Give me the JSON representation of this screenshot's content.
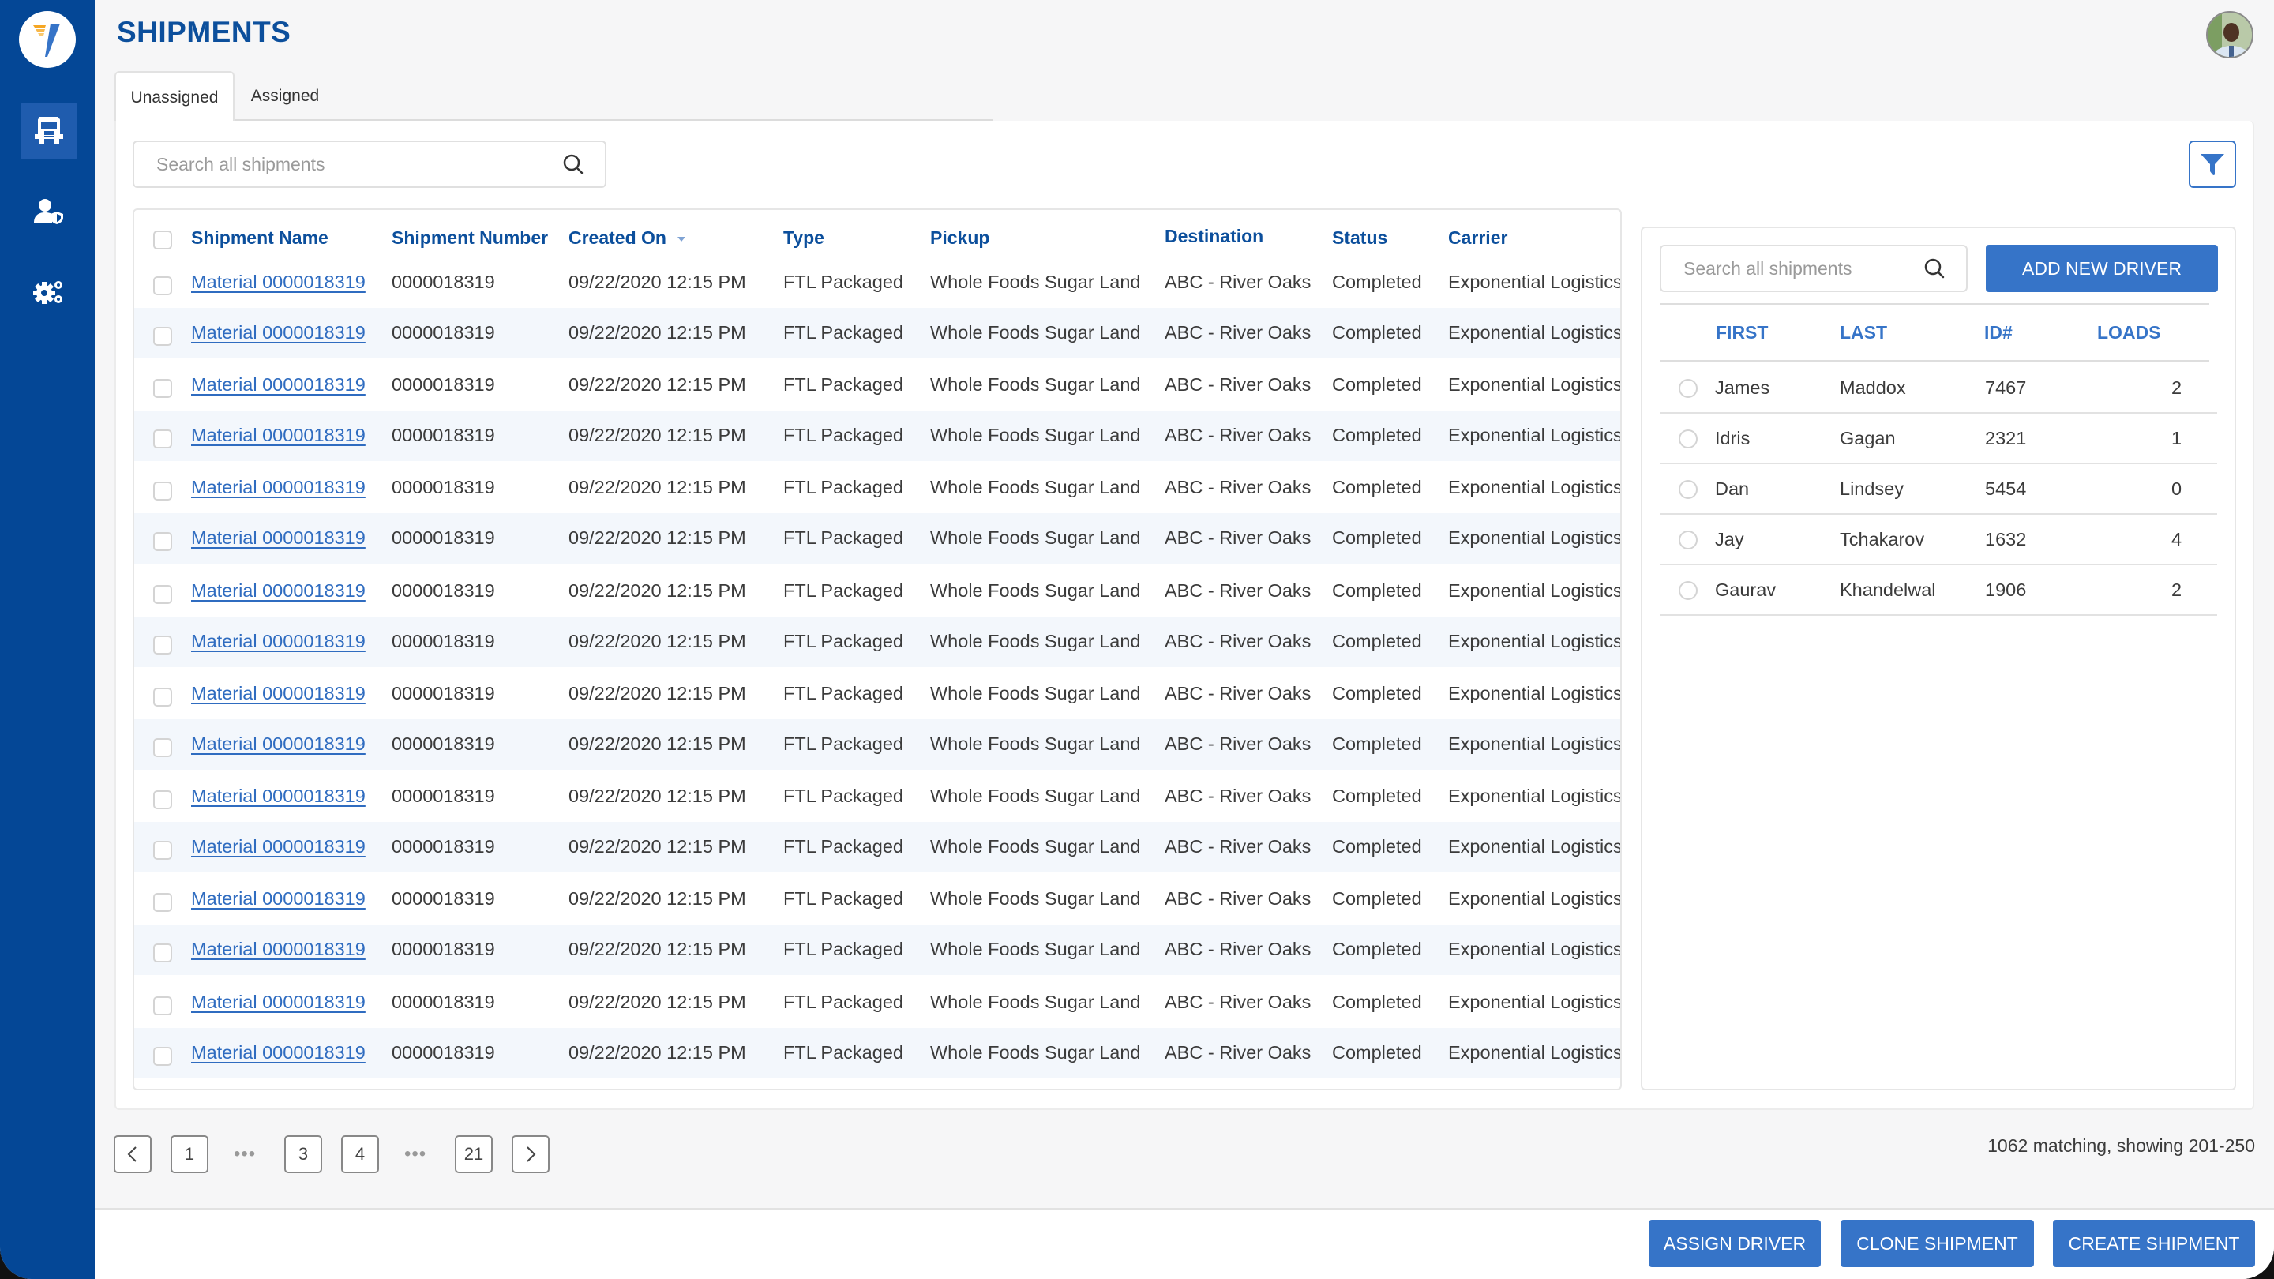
{
  "app": {
    "title": "SHIPMENTS",
    "brand_color": "#044796",
    "accent_color": "#3674c8"
  },
  "sidebar": {
    "items": [
      {
        "name": "shipments",
        "icon": "truck-icon",
        "active": true
      },
      {
        "name": "drivers",
        "icon": "user-shield-icon",
        "active": false
      },
      {
        "name": "settings",
        "icon": "gears-icon",
        "active": false
      }
    ]
  },
  "tabs": [
    {
      "label": "Unassigned",
      "active": true
    },
    {
      "label": "Assigned",
      "active": false
    }
  ],
  "search": {
    "placeholder": "Search all shipments",
    "value": ""
  },
  "table": {
    "columns": [
      "Shipment Name",
      "Shipment Number",
      "Created On",
      "Type",
      "Pickup",
      "Destination",
      "Status",
      "Carrier"
    ],
    "sorted_column": "Created On",
    "sort_direction": "desc",
    "rows": [
      {
        "name": "Material 0000018319",
        "number": "0000018319",
        "created": "09/22/2020 12:15 PM",
        "type": "FTL Packaged",
        "pickup": "Whole Foods Sugar Land",
        "destination": "ABC - River Oaks",
        "status": "Completed",
        "carrier": "Exponential Logistics"
      },
      {
        "name": "Material 0000018319",
        "number": "0000018319",
        "created": "09/22/2020 12:15 PM",
        "type": "FTL Packaged",
        "pickup": "Whole Foods Sugar Land",
        "destination": "ABC - River Oaks",
        "status": "Completed",
        "carrier": "Exponential Logistics"
      },
      {
        "name": "Material 0000018319",
        "number": "0000018319",
        "created": "09/22/2020 12:15 PM",
        "type": "FTL Packaged",
        "pickup": "Whole Foods Sugar Land",
        "destination": "ABC - River Oaks",
        "status": "Completed",
        "carrier": "Exponential Logistics"
      },
      {
        "name": "Material 0000018319",
        "number": "0000018319",
        "created": "09/22/2020 12:15 PM",
        "type": "FTL Packaged",
        "pickup": "Whole Foods Sugar Land",
        "destination": "ABC - River Oaks",
        "status": "Completed",
        "carrier": "Exponential Logistics"
      },
      {
        "name": "Material 0000018319",
        "number": "0000018319",
        "created": "09/22/2020 12:15 PM",
        "type": "FTL Packaged",
        "pickup": "Whole Foods Sugar Land",
        "destination": "ABC - River Oaks",
        "status": "Completed",
        "carrier": "Exponential Logistics"
      },
      {
        "name": "Material 0000018319",
        "number": "0000018319",
        "created": "09/22/2020 12:15 PM",
        "type": "FTL Packaged",
        "pickup": "Whole Foods Sugar Land",
        "destination": "ABC - River Oaks",
        "status": "Completed",
        "carrier": "Exponential Logistics"
      },
      {
        "name": "Material 0000018319",
        "number": "0000018319",
        "created": "09/22/2020 12:15 PM",
        "type": "FTL Packaged",
        "pickup": "Whole Foods Sugar Land",
        "destination": "ABC - River Oaks",
        "status": "Completed",
        "carrier": "Exponential Logistics"
      },
      {
        "name": "Material 0000018319",
        "number": "0000018319",
        "created": "09/22/2020 12:15 PM",
        "type": "FTL Packaged",
        "pickup": "Whole Foods Sugar Land",
        "destination": "ABC - River Oaks",
        "status": "Completed",
        "carrier": "Exponential Logistics"
      },
      {
        "name": "Material 0000018319",
        "number": "0000018319",
        "created": "09/22/2020 12:15 PM",
        "type": "FTL Packaged",
        "pickup": "Whole Foods Sugar Land",
        "destination": "ABC - River Oaks",
        "status": "Completed",
        "carrier": "Exponential Logistics"
      },
      {
        "name": "Material 0000018319",
        "number": "0000018319",
        "created": "09/22/2020 12:15 PM",
        "type": "FTL Packaged",
        "pickup": "Whole Foods Sugar Land",
        "destination": "ABC - River Oaks",
        "status": "Completed",
        "carrier": "Exponential Logistics"
      },
      {
        "name": "Material 0000018319",
        "number": "0000018319",
        "created": "09/22/2020 12:15 PM",
        "type": "FTL Packaged",
        "pickup": "Whole Foods Sugar Land",
        "destination": "ABC - River Oaks",
        "status": "Completed",
        "carrier": "Exponential Logistics"
      },
      {
        "name": "Material 0000018319",
        "number": "0000018319",
        "created": "09/22/2020 12:15 PM",
        "type": "FTL Packaged",
        "pickup": "Whole Foods Sugar Land",
        "destination": "ABC - River Oaks",
        "status": "Completed",
        "carrier": "Exponential Logistics"
      },
      {
        "name": "Material 0000018319",
        "number": "0000018319",
        "created": "09/22/2020 12:15 PM",
        "type": "FTL Packaged",
        "pickup": "Whole Foods Sugar Land",
        "destination": "ABC - River Oaks",
        "status": "Completed",
        "carrier": "Exponential Logistics"
      },
      {
        "name": "Material 0000018319",
        "number": "0000018319",
        "created": "09/22/2020 12:15 PM",
        "type": "FTL Packaged",
        "pickup": "Whole Foods Sugar Land",
        "destination": "ABC - River Oaks",
        "status": "Completed",
        "carrier": "Exponential Logistics"
      },
      {
        "name": "Material 0000018319",
        "number": "0000018319",
        "created": "09/22/2020 12:15 PM",
        "type": "FTL Packaged",
        "pickup": "Whole Foods Sugar Land",
        "destination": "ABC - River Oaks",
        "status": "Completed",
        "carrier": "Exponential Logistics"
      },
      {
        "name": "Material 0000018319",
        "number": "0000018319",
        "created": "09/22/2020 12:15 PM",
        "type": "FTL Packaged",
        "pickup": "Whole Foods Sugar Land",
        "destination": "ABC - River Oaks",
        "status": "Completed",
        "carrier": "Exponential Logistics"
      }
    ]
  },
  "drivers": {
    "search_placeholder": "Search all shipments",
    "search_value": "",
    "add_button_label": "ADD NEW DRIVER",
    "columns": [
      "FIRST",
      "LAST",
      "ID#",
      "LOADS"
    ],
    "rows": [
      {
        "first": "James",
        "last": "Maddox",
        "id": "7467",
        "loads": "2"
      },
      {
        "first": "Idris",
        "last": "Gagan",
        "id": "2321",
        "loads": "1"
      },
      {
        "first": "Dan",
        "last": "Lindsey",
        "id": "5454",
        "loads": "0"
      },
      {
        "first": "Jay",
        "last": "Tchakarov",
        "id": "1632",
        "loads": "4"
      },
      {
        "first": "Gaurav",
        "last": "Khandelwal",
        "id": "1906",
        "loads": "2"
      }
    ]
  },
  "pagination": {
    "pages": [
      "1",
      "…",
      "3",
      "4",
      "…",
      "21"
    ],
    "prev_icon": "chevron-left-icon",
    "next_icon": "chevron-right-icon",
    "ellipsis": "•••",
    "summary": "1062 matching, showing 201-250"
  },
  "footer": {
    "assign_driver_label": "ASSIGN DRIVER",
    "clone_shipment_label": "CLONE SHIPMENT",
    "create_shipment_label": "CREATE SHIPMENT"
  }
}
